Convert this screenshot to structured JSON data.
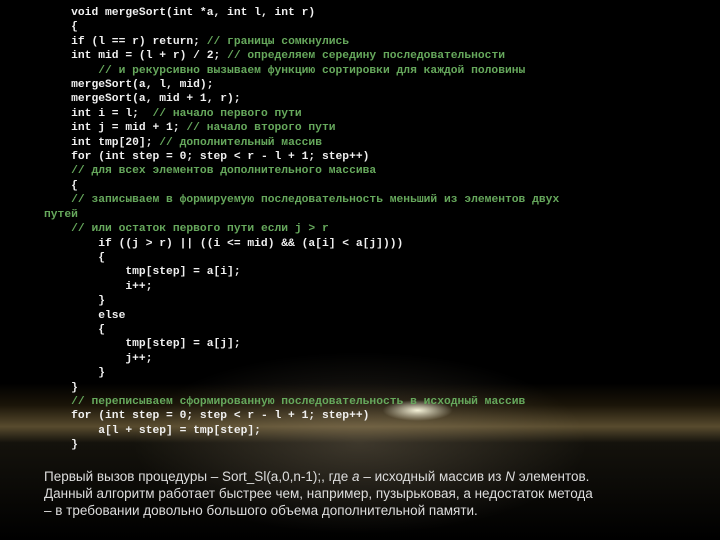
{
  "code": [
    {
      "i": 1,
      "s": [
        [
          "wh",
          "void mergeSort(int *a, int l, int r)"
        ]
      ]
    },
    {
      "i": 1,
      "s": [
        [
          "wh",
          "{"
        ]
      ]
    },
    {
      "i": 1,
      "s": [
        [
          "wh",
          "if (l == r) return; "
        ],
        [
          "gr",
          "// границы сомкнулись"
        ]
      ]
    },
    {
      "i": 1,
      "s": [
        [
          "wh",
          "int mid = (l + r) / 2; "
        ],
        [
          "gr",
          "// определяем середину последовательности"
        ]
      ]
    },
    {
      "i": 2,
      "s": [
        [
          "gr",
          "// и рекурсивно вызываем функцию сортировки для каждой половины"
        ]
      ]
    },
    {
      "i": 1,
      "s": [
        [
          "wh",
          "mergeSort(a, l, mid);"
        ]
      ]
    },
    {
      "i": 1,
      "s": [
        [
          "wh",
          "mergeSort(a, mid + 1, r);"
        ]
      ]
    },
    {
      "i": 1,
      "s": [
        [
          "wh",
          "int i = l;  "
        ],
        [
          "gr",
          "// начало первого пути"
        ]
      ]
    },
    {
      "i": 1,
      "s": [
        [
          "wh",
          "int j = mid + 1; "
        ],
        [
          "gr",
          "// начало второго пути"
        ]
      ]
    },
    {
      "i": 1,
      "s": [
        [
          "wh",
          "int tmp[20]; "
        ],
        [
          "gr",
          "// дополнительный массив"
        ]
      ]
    },
    {
      "i": 1,
      "s": [
        [
          "wh",
          "for (int step = 0; step < r - l + 1; step++)"
        ]
      ]
    },
    {
      "i": 1,
      "s": [
        [
          "gr",
          "// для всех элементов дополнительного массива"
        ]
      ]
    },
    {
      "i": 1,
      "s": [
        [
          "wh",
          "{"
        ]
      ]
    },
    {
      "i": 1,
      "s": [
        [
          "gr",
          "// записываем в формируемую последовательность меньший из элементов двух"
        ]
      ]
    },
    {
      "i": 0,
      "s": [
        [
          "gr",
          "путей"
        ]
      ]
    },
    {
      "i": 1,
      "s": [
        [
          "gr",
          "// или остаток первого пути если j > r"
        ]
      ]
    },
    {
      "i": 2,
      "s": [
        [
          "wh",
          "if ((j > r) || ((i <= mid) && (a[i] < a[j])))"
        ]
      ]
    },
    {
      "i": 2,
      "s": [
        [
          "wh",
          "{"
        ]
      ]
    },
    {
      "i": 3,
      "s": [
        [
          "wh",
          "tmp[step] = a[i];"
        ]
      ]
    },
    {
      "i": 3,
      "s": [
        [
          "wh",
          "i++;"
        ]
      ]
    },
    {
      "i": 2,
      "s": [
        [
          "wh",
          "}"
        ]
      ]
    },
    {
      "i": 2,
      "s": [
        [
          "wh",
          "else"
        ]
      ]
    },
    {
      "i": 2,
      "s": [
        [
          "wh",
          "{"
        ]
      ]
    },
    {
      "i": 3,
      "s": [
        [
          "wh",
          "tmp[step] = a[j];"
        ]
      ]
    },
    {
      "i": 3,
      "s": [
        [
          "wh",
          "j++;"
        ]
      ]
    },
    {
      "i": 2,
      "s": [
        [
          "wh",
          "}"
        ]
      ]
    },
    {
      "i": 1,
      "s": [
        [
          "wh",
          "}"
        ]
      ]
    },
    {
      "i": 1,
      "s": [
        [
          "gr",
          "// переписываем сформированную последовательность в исходный массив"
        ]
      ]
    },
    {
      "i": 1,
      "s": [
        [
          "wh",
          "for (int step = 0; step < r - l + 1; step++)"
        ]
      ]
    },
    {
      "i": 2,
      "s": [
        [
          "wh",
          "a[l + step] = tmp[step];"
        ]
      ]
    },
    {
      "i": 1,
      "s": [
        [
          "wh",
          "}"
        ]
      ]
    }
  ],
  "desc": {
    "l1a": "Первый вызов процедуры – Sort_Sl(a,0,n-1);, где ",
    "l1b": "a",
    "l1c": " – исходный массив из ",
    "l1d": "N",
    "l1e": " элементов.",
    "l2": "Данный алгоритм работает быстрее чем, например, пузырьковая, а недостаток метода",
    "l3": "– в требовании довольно большого объема дополнительной памяти."
  }
}
